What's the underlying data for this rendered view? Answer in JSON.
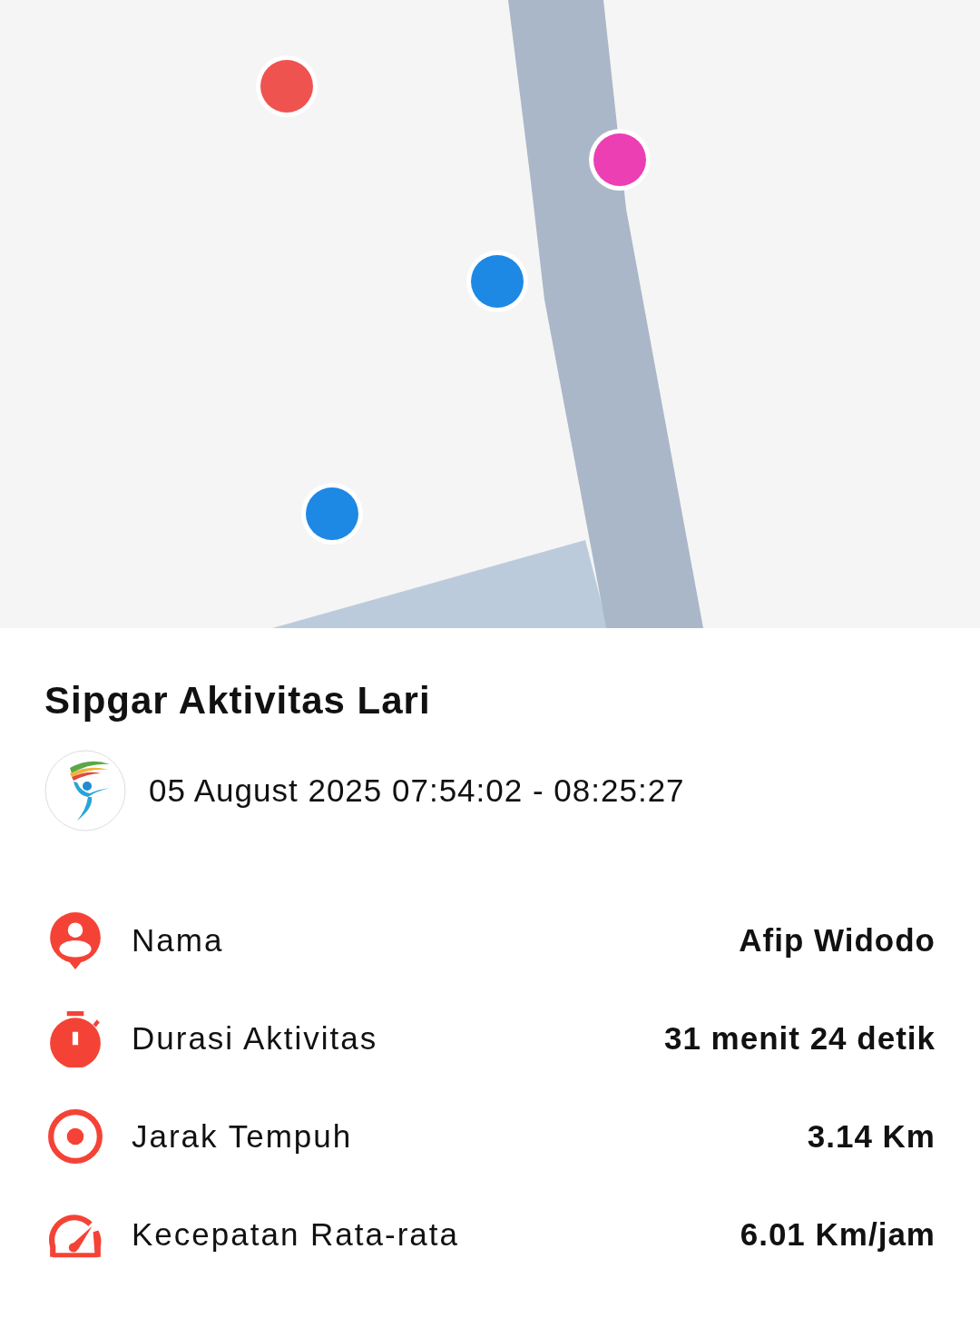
{
  "title": "Sipgar Aktivitas Lari",
  "session": {
    "datetime": "05 August 2025 07:54:02 - 08:25:27"
  },
  "stats": [
    {
      "kind": "person",
      "label": "Nama",
      "value": "Afip Widodo"
    },
    {
      "kind": "timer",
      "label": "Durasi Aktivitas",
      "value": "31 menit 24 detik"
    },
    {
      "kind": "target",
      "label": "Jarak Tempuh",
      "value": "3.14 Km"
    },
    {
      "kind": "speed",
      "label": "Kecepatan Rata-rata",
      "value": "6.01 Km/jam"
    }
  ]
}
